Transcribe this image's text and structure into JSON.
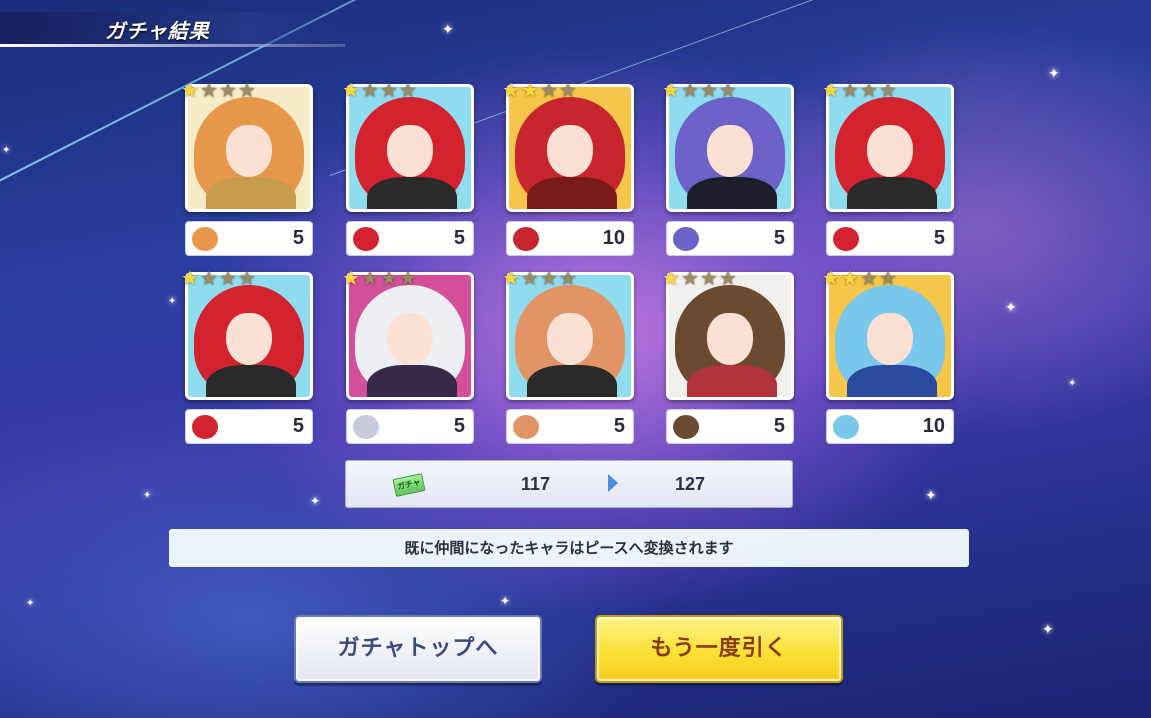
{
  "header": {
    "title": "ガチャ結果"
  },
  "results": [
    {
      "rarity": 1,
      "max_stars": 4,
      "pieces": "5",
      "colors": {
        "bg": "#f6ecc7",
        "hair": "#e7974a",
        "body": "#c89a4c",
        "icon": "#e7974a"
      }
    },
    {
      "rarity": 1,
      "max_stars": 4,
      "pieces": "5",
      "colors": {
        "bg": "#8fdcef",
        "hair": "#d3232f",
        "body": "#2a2a2a",
        "icon": "#d3232f"
      }
    },
    {
      "rarity": 2,
      "max_stars": 4,
      "pieces": "10",
      "colors": {
        "bg": "#f5c64a",
        "hair": "#c8262e",
        "body": "#7a1a1a",
        "icon": "#c8262e"
      }
    },
    {
      "rarity": 1,
      "max_stars": 4,
      "pieces": "5",
      "colors": {
        "bg": "#8fdcef",
        "hair": "#6d62c8",
        "body": "#1e1e2a",
        "icon": "#6d62c8"
      }
    },
    {
      "rarity": 1,
      "max_stars": 4,
      "pieces": "5",
      "colors": {
        "bg": "#8fdcef",
        "hair": "#d3232f",
        "body": "#2a2a2a",
        "icon": "#d3232f"
      }
    },
    {
      "rarity": 1,
      "max_stars": 4,
      "pieces": "5",
      "colors": {
        "bg": "#8fdcef",
        "hair": "#d3232f",
        "body": "#2a2a2a",
        "icon": "#d3232f"
      }
    },
    {
      "rarity": 1,
      "max_stars": 4,
      "pieces": "5",
      "colors": {
        "bg": "#d4509a",
        "hair": "#eeeef5",
        "body": "#3a2a4a",
        "icon": "#c9c9dc"
      }
    },
    {
      "rarity": 1,
      "max_stars": 4,
      "pieces": "5",
      "colors": {
        "bg": "#8fdcef",
        "hair": "#e39464",
        "body": "#2a2a2a",
        "icon": "#e39464"
      }
    },
    {
      "rarity": 1,
      "max_stars": 4,
      "pieces": "5",
      "colors": {
        "bg": "#f2f0ee",
        "hair": "#6b4a32",
        "body": "#b2333a",
        "icon": "#6b4a32"
      }
    },
    {
      "rarity": 2,
      "max_stars": 4,
      "pieces": "10",
      "colors": {
        "bg": "#f5c64a",
        "hair": "#79c7ea",
        "body": "#2a4aa0",
        "icon": "#79c7ea"
      }
    }
  ],
  "tickets": {
    "icon": "ticket-icon",
    "icon_text": "ガチャ",
    "before": "117",
    "after": "127"
  },
  "notice": "既に仲間になったキャラはピースへ変換されます",
  "buttons": {
    "top": "ガチャトップへ",
    "again": "もう一度引く"
  },
  "theme": {
    "accent_yellow": "#fbe036",
    "star_gold": "#ffd83a"
  }
}
